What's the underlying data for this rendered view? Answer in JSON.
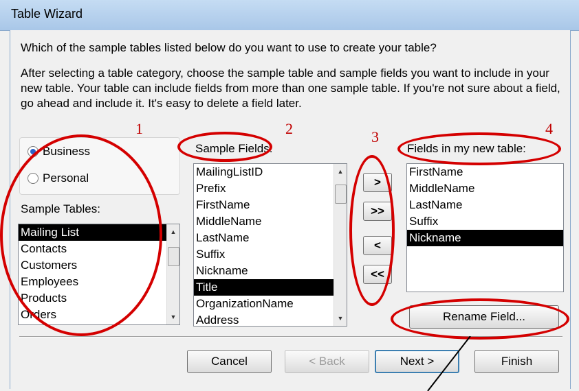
{
  "window": {
    "title": "Table Wizard"
  },
  "intro": {
    "question": "Which of the sample tables listed below do you want to use to create your table?",
    "description": "After selecting a table category, choose the sample table and sample fields you want to include in your new table. Your table can include fields from more than one sample table. If you're not sure about a field, go ahead and include it. It's easy to delete a field later."
  },
  "category": {
    "options": [
      {
        "label": "Business",
        "selected": true
      },
      {
        "label": "Personal",
        "selected": false
      }
    ]
  },
  "sample_tables": {
    "label": "Sample Tables:",
    "items": [
      "Mailing List",
      "Contacts",
      "Customers",
      "Employees",
      "Products",
      "Orders"
    ],
    "selected_index": 0
  },
  "sample_fields": {
    "label": "Sample Fields:",
    "items": [
      "MailingListID",
      "Prefix",
      "FirstName",
      "MiddleName",
      "LastName",
      "Suffix",
      "Nickname",
      "Title",
      "OrganizationName",
      "Address"
    ],
    "selected_index": 7
  },
  "move_buttons": {
    "add_one": ">",
    "add_all": ">>",
    "remove_one": "<",
    "remove_all": "<<"
  },
  "new_fields": {
    "label": "Fields in my new table:",
    "items": [
      "FirstName",
      "MiddleName",
      "LastName",
      "Suffix",
      "Nickname"
    ],
    "selected_index": 4
  },
  "rename_button": "Rename Field...",
  "footer": {
    "cancel": "Cancel",
    "back": "< Back",
    "next": "Next >",
    "finish": "Finish"
  },
  "annotations": {
    "n1": "1",
    "n2": "2",
    "n3": "3",
    "n4": "4",
    "color": "#d40000"
  }
}
